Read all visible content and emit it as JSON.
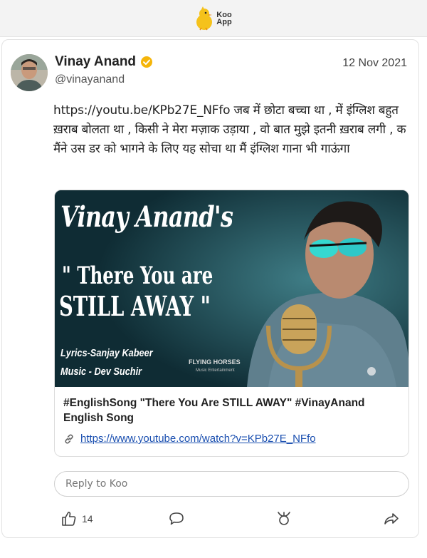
{
  "app": {
    "logo_line1": "Koo",
    "logo_line2": "App",
    "brand_color": "#f5c21b"
  },
  "post": {
    "author_name": "Vinay Anand",
    "handle": "@vinayanand",
    "date": "12 Nov 2021",
    "verified_color": "#f5b50a",
    "text": "https://youtu.be/KPb27E_NFfo जब में छोटा बच्चा था , में इंग्लिश बहुत ख़राब बोलता था , किसी ने मेरा मज़ाक उड़ाया , वो बात मुझे इतनी ख़राब लगी , क मैंने उस डर को भागने के लिए यह सोचा था मैं इंग्लिश गाना भी गाऊंगा"
  },
  "preview": {
    "thumb_title1": "Vinay Anand's",
    "thumb_title2": "\" There You are",
    "thumb_title3": "STILL AWAY \"",
    "thumb_lyrics": "Lyrics-Sanjay Kabeer",
    "thumb_music": "Music - Dev Suchir",
    "thumb_label1": "FLYING HORSES",
    "thumb_label2": "Music Entertainment",
    "title": "#EnglishSong \"There You Are STILL AWAY\" #VinayAnand English Song",
    "url": "https://www.youtube.com/watch?v=KPb27E_NFfo",
    "link_color": "#1a4fb0"
  },
  "reply": {
    "placeholder": "Reply to Koo"
  },
  "actions": {
    "like_count": "14"
  }
}
